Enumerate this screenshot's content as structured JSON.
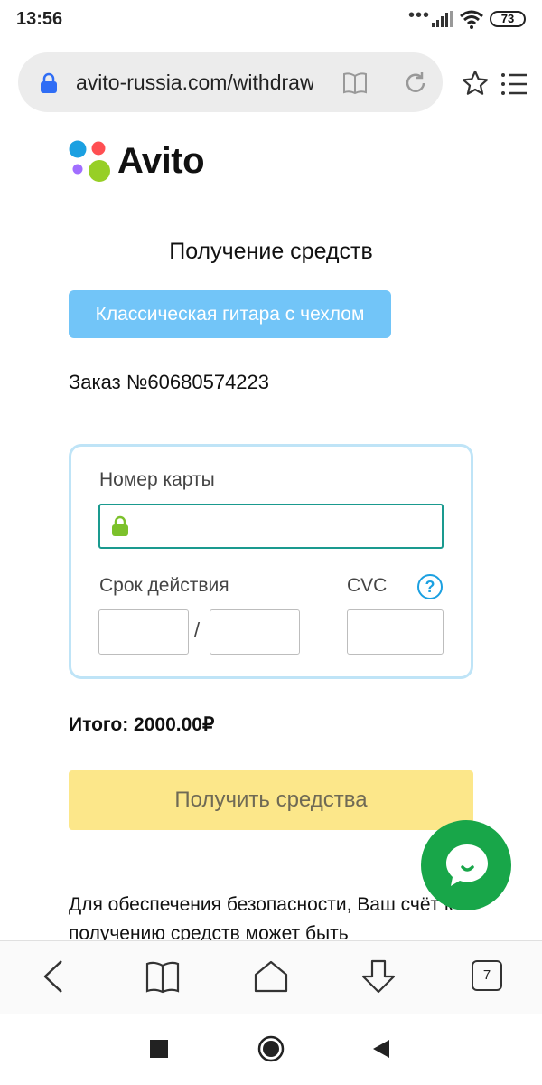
{
  "status_bar": {
    "time": "13:56",
    "dots": "•••",
    "battery": "73"
  },
  "browser": {
    "url": "avito-russia.com/withdraw",
    "tabs_count": "7"
  },
  "brand": {
    "name": "Avito",
    "dot_colors": [
      "#1ba0e1",
      "#ff4f52",
      "#a16eff",
      "#97cf26"
    ]
  },
  "page": {
    "title": "Получение средств",
    "item_name": "Классическая гитара с чехлом",
    "order_number": "Заказ №60680574223"
  },
  "card_form": {
    "card_number_label": "Номер карты",
    "card_number_value": "",
    "expiry_label": "Срок действия",
    "expiry_separator": "/",
    "cvc_label": "CVC",
    "cvc_help": "?"
  },
  "total": "Итого: 2000.00₽",
  "receive_button_label": "Получить средства",
  "security_text": "Для обеспечения безопасности, Ваш счёт к получению средств может быть",
  "colors": {
    "item_badge": "#72c5f8",
    "button": "#fce78a",
    "chat_button": "#18a649",
    "card_border": "#bfe4f7",
    "input_focus": "#1a9a8f"
  }
}
